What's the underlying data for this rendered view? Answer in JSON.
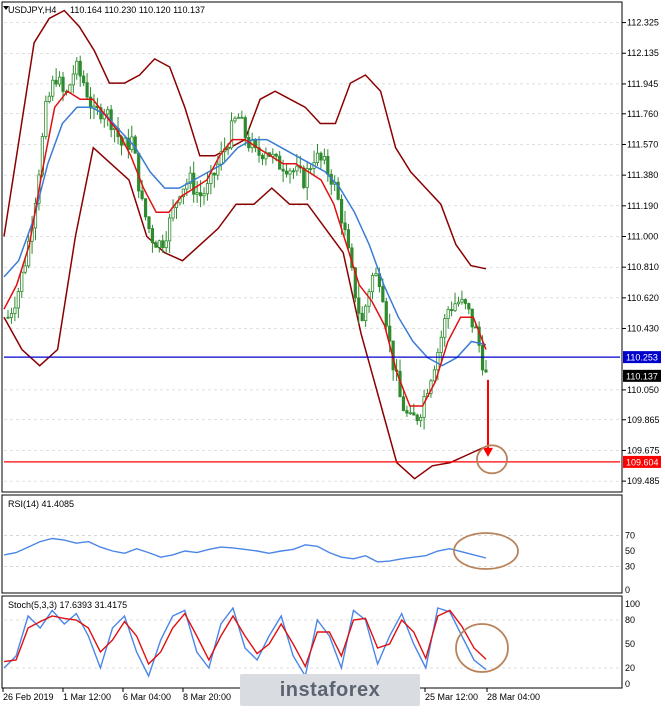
{
  "window": {
    "symbol_label": "USDJPY,H4",
    "ohlc_label": "110.164 110.230 110.120 110.137"
  },
  "colors": {
    "background": "#ffffff",
    "grid": "#c0c0c0",
    "candle": "#2e8b2e",
    "bollinger": "#8b0000",
    "ma_fast": "#e01010",
    "ma_slow": "#3a7bd5",
    "support_line": "#0000cc",
    "target_line": "#ff0000",
    "annotation_circle": "#b9825a",
    "rsi_line": "#4a86e8",
    "stoch_main": "#4a86e8",
    "stoch_signal": "#e01010"
  },
  "watermark": {
    "text": "instaforex"
  },
  "chart_data": [
    {
      "type": "candlestick",
      "title": "USDJPY,H4",
      "price_axis_ticks": [
        "112.325",
        "112.135",
        "111.945",
        "111.760",
        "111.570",
        "111.380",
        "111.190",
        "111.000",
        "110.810",
        "110.620",
        "110.430",
        "110.253",
        "110.137",
        "110.050",
        "109.865",
        "109.675",
        "109.604",
        "109.485"
      ],
      "price_tick_values": [
        112.325,
        112.135,
        111.945,
        111.76,
        111.57,
        111.38,
        111.19,
        111.0,
        110.81,
        110.62,
        110.43,
        110.05,
        109.865,
        109.675,
        109.485
      ],
      "ylim": [
        109.43,
        112.44
      ],
      "time_labels": [
        "26 Feb 2019",
        "1 Mar 12:00",
        "6 Mar 04:00",
        "8 Mar 20:00",
        "25 Mar 12:00",
        "28 Mar 04:00"
      ],
      "horizontal_lines": [
        {
          "name": "support",
          "value": 110.253,
          "label": "110.253"
        },
        {
          "name": "target",
          "value": 109.604,
          "label": "109.604"
        }
      ],
      "current_price_label": "110.137",
      "current_price": 110.137,
      "close_path": [
        110.5,
        110.65,
        110.9,
        111.3,
        111.8,
        112.0,
        111.85,
        112.05,
        111.95,
        111.75,
        111.8,
        111.7,
        111.55,
        111.6,
        111.2,
        111.0,
        110.95,
        111.1,
        111.3,
        111.35,
        111.25,
        111.3,
        111.45,
        111.6,
        111.75,
        111.6,
        111.5,
        111.55,
        111.45,
        111.45,
        111.4,
        111.35,
        111.5,
        111.45,
        111.35,
        111.1,
        110.75,
        110.45,
        110.75,
        110.75,
        110.3,
        110.0,
        109.85,
        109.9,
        110.1,
        110.3,
        110.55,
        110.6,
        110.55,
        110.4,
        110.137
      ],
      "bollinger_upper": [
        111.0,
        111.6,
        112.2,
        112.35,
        112.4,
        112.3,
        112.15,
        111.95,
        111.95,
        112.0,
        112.1,
        112.05,
        111.8,
        111.5,
        111.5,
        111.55,
        111.6,
        111.85,
        111.9,
        111.85,
        111.8,
        111.7,
        111.7,
        111.95,
        112.0,
        111.9,
        111.55,
        111.4,
        111.3,
        111.2,
        110.95,
        110.82,
        110.8
      ],
      "bollinger_lower": [
        110.5,
        110.3,
        110.2,
        110.3,
        111.0,
        111.55,
        111.45,
        111.35,
        111.0,
        110.9,
        110.85,
        110.95,
        111.05,
        111.2,
        111.2,
        111.3,
        111.2,
        111.2,
        111.05,
        110.9,
        110.4,
        110.0,
        109.6,
        109.5,
        109.58,
        109.6,
        109.65,
        109.7
      ],
      "ma_fast": [
        110.55,
        110.7,
        110.95,
        111.4,
        111.8,
        111.9,
        111.85,
        111.85,
        111.75,
        111.65,
        111.5,
        111.3,
        111.15,
        111.15,
        111.25,
        111.3,
        111.35,
        111.5,
        111.6,
        111.6,
        111.55,
        111.5,
        111.45,
        111.45,
        111.4,
        111.35,
        111.2,
        110.95,
        110.7,
        110.6,
        110.45,
        110.15,
        109.95,
        109.95,
        110.1,
        110.35,
        110.5,
        110.5,
        110.3
      ],
      "ma_slow": [
        110.75,
        110.85,
        111.1,
        111.45,
        111.7,
        111.8,
        111.8,
        111.75,
        111.65,
        111.55,
        111.4,
        111.3,
        111.3,
        111.35,
        111.4,
        111.45,
        111.55,
        111.6,
        111.6,
        111.55,
        111.5,
        111.45,
        111.4,
        111.3,
        111.15,
        110.95,
        110.7,
        110.5,
        110.35,
        110.25,
        110.2,
        110.25,
        110.35,
        110.33
      ]
    },
    {
      "type": "line",
      "title": "RSI(14) 41.4085",
      "ylim": [
        0,
        100
      ],
      "y_ticks": [
        "70",
        "50",
        "30",
        "0"
      ],
      "levels": [
        70,
        30
      ],
      "series": [
        {
          "name": "RSI(14)",
          "values": [
            45,
            48,
            55,
            62,
            66,
            64,
            60,
            62,
            55,
            50,
            47,
            53,
            48,
            42,
            45,
            50,
            48,
            52,
            55,
            54,
            52,
            50,
            47,
            50,
            52,
            58,
            56,
            48,
            42,
            40,
            44,
            36,
            37,
            40,
            42,
            44,
            50,
            53,
            49,
            45,
            41
          ]
        }
      ]
    },
    {
      "type": "line",
      "title": "Stoch(5,3,3) 17.6393 31.4175",
      "ylim": [
        0,
        100
      ],
      "y_ticks": [
        "100",
        "80",
        "50",
        "20",
        "0"
      ],
      "levels": [
        80,
        20
      ],
      "series": [
        {
          "name": "Stoch main",
          "values": [
            20,
            35,
            85,
            70,
            92,
            75,
            88,
            60,
            20,
            70,
            85,
            40,
            10,
            55,
            85,
            92,
            40,
            20,
            75,
            95,
            45,
            30,
            60,
            85,
            35,
            10,
            80,
            60,
            20,
            92,
            80,
            25,
            60,
            88,
            50,
            20,
            95,
            90,
            60,
            30,
            18
          ]
        },
        {
          "name": "Stoch signal",
          "values": [
            28,
            30,
            70,
            78,
            85,
            82,
            80,
            70,
            40,
            55,
            78,
            60,
            25,
            40,
            70,
            88,
            60,
            30,
            60,
            85,
            60,
            38,
            50,
            75,
            50,
            22,
            65,
            65,
            35,
            80,
            82,
            45,
            50,
            80,
            65,
            32,
            85,
            92,
            72,
            45,
            31
          ]
        }
      ]
    }
  ]
}
